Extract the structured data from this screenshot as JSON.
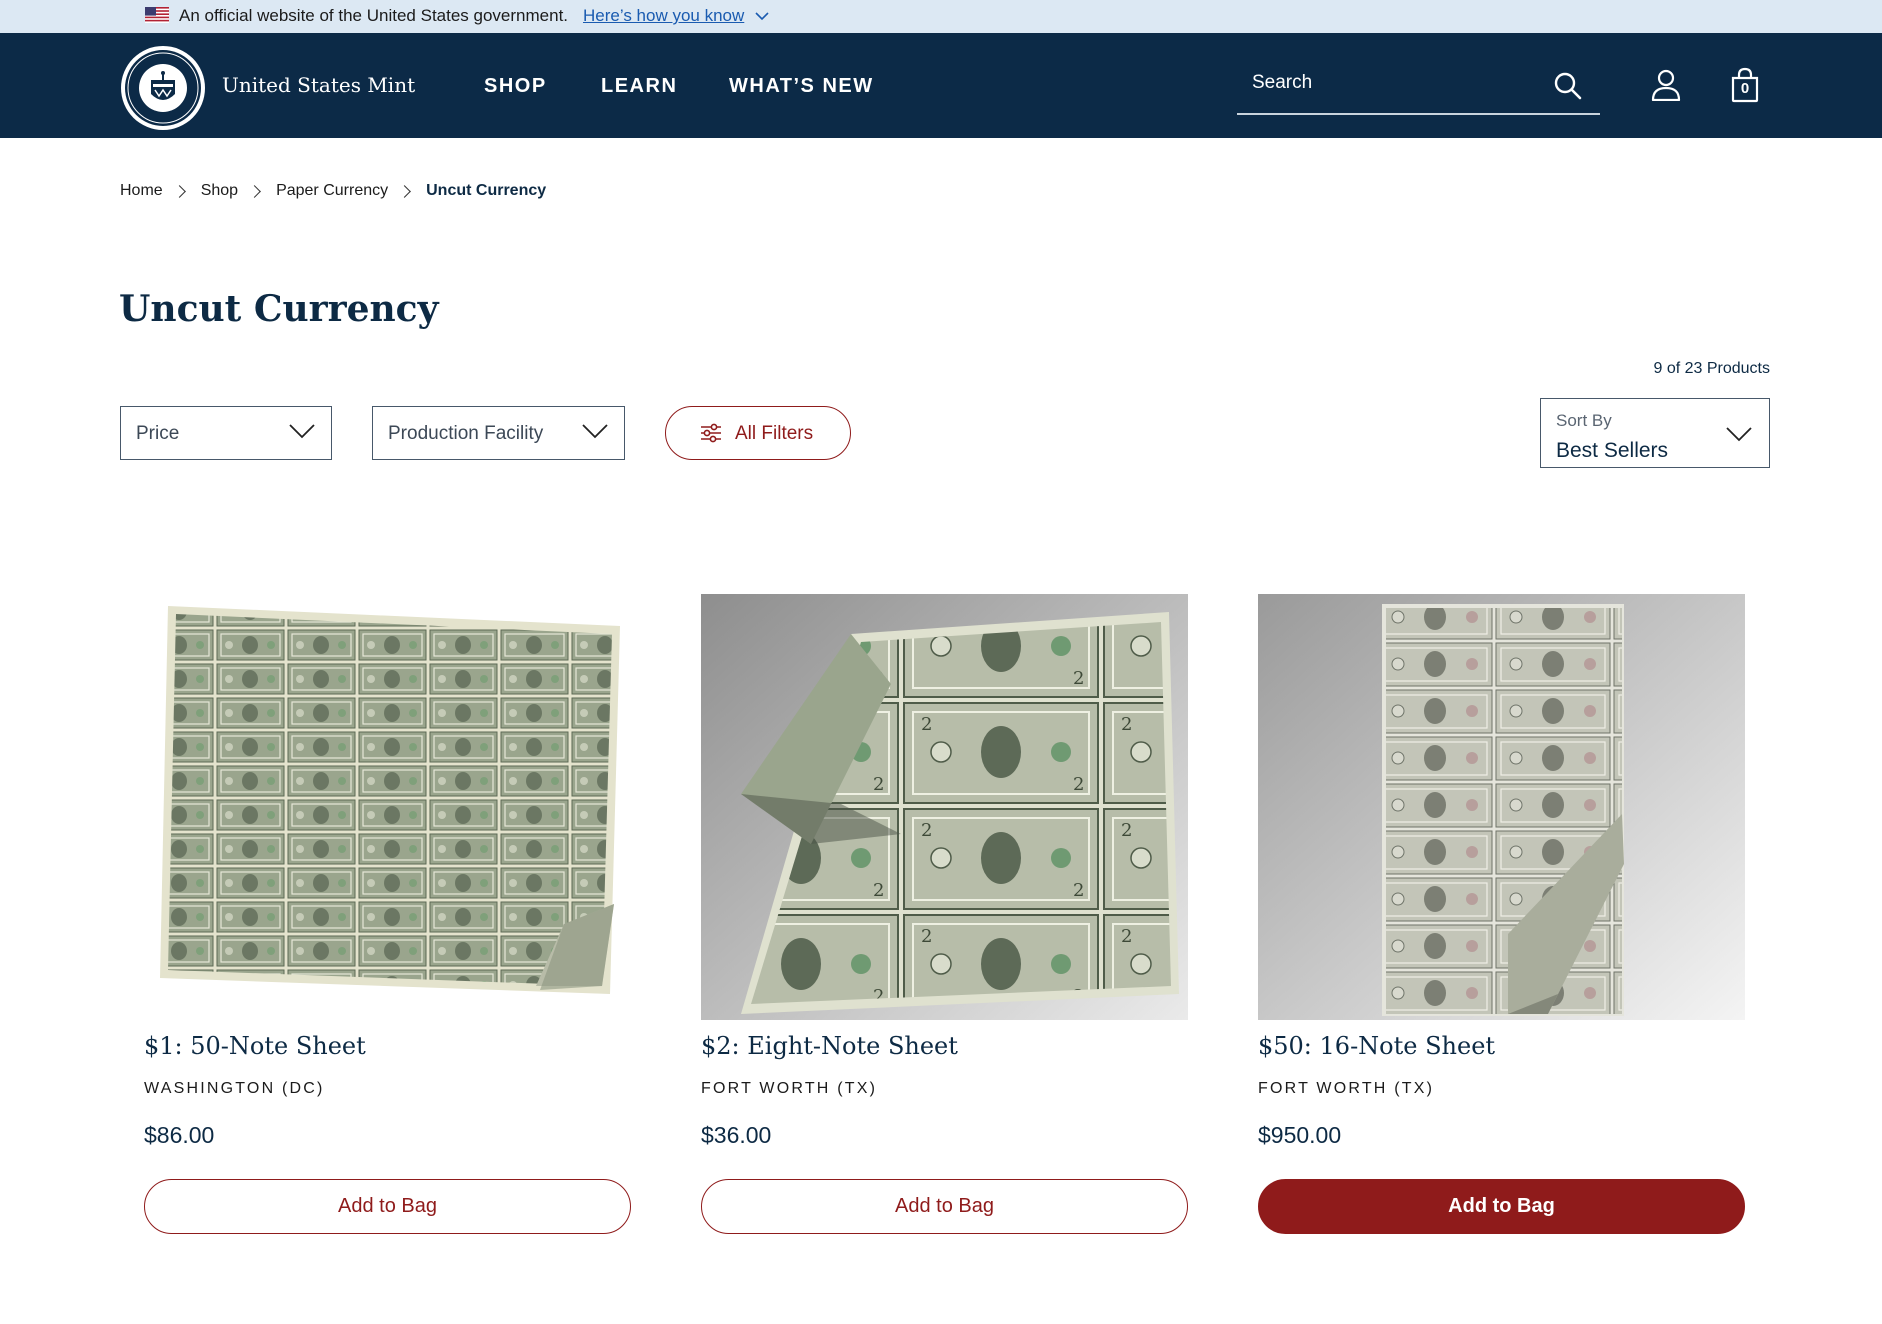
{
  "gov_banner": {
    "text": "An official website of the United States government.",
    "link": "Here’s how you know"
  },
  "header": {
    "brand": "United States Mint",
    "nav": [
      "SHOP",
      "LEARN",
      "WHAT’S NEW"
    ],
    "search_placeholder": "Search",
    "bag_count": "0"
  },
  "breadcrumb": [
    "Home",
    "Shop",
    "Paper Currency",
    "Uncut Currency"
  ],
  "page_title": "Uncut Currency",
  "product_count": "9 of 23 Products",
  "filters": {
    "price": "Price",
    "facility": "Production Facility",
    "all_filters": "All Filters"
  },
  "sort": {
    "caption": "Sort By",
    "value": "Best Sellers"
  },
  "products": [
    {
      "name": "$1: 50-Note Sheet",
      "facility": "WASHINGTON (DC)",
      "price": "$86.00",
      "button": "Add to Bag"
    },
    {
      "name": "$2: Eight-Note Sheet",
      "facility": "FORT WORTH (TX)",
      "price": "$36.00",
      "button": "Add to Bag"
    },
    {
      "name": "$50: 16-Note Sheet",
      "facility": "FORT WORTH (TX)",
      "price": "$950.00",
      "button": "Add to Bag"
    }
  ],
  "colors": {
    "header_bg": "#0c2a47",
    "banner_bg": "#dce8f3",
    "accent": "#8f1b1b"
  }
}
